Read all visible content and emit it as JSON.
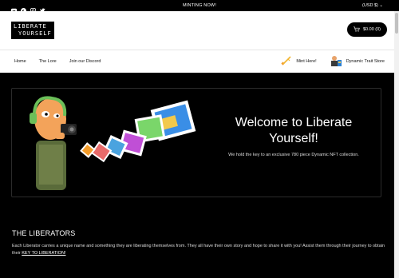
{
  "topbar": {
    "announcement": "MINTING NOW!",
    "currency": "(USD $) ⌄",
    "social_icons": [
      "discord-icon",
      "opensea-icon",
      "instagram-icon",
      "twitter-icon"
    ]
  },
  "header": {
    "logo_line1": "LIBERATE",
    "logo_line2": "YOURSELF",
    "cart_label": "$0.00 (0)"
  },
  "nav": {
    "items": [
      "Home",
      "The Lore",
      "Join our Discord"
    ],
    "mint_label": "Mint Here!",
    "store_label": "Dynamic Trait Store"
  },
  "hero": {
    "title": "Welcome to Liberate Yourself!",
    "text": "We hold the key to an exclusive 780 piece Dynamic NFT collection."
  },
  "section": {
    "title": "THE LIBERATORS",
    "text": "Each Liberator carries a unique name and something they are liberating themselves from. They all have their own story and hope to share it with you! Assist them through their journey to obtain their ",
    "link": "KEY TO LIBERATION!"
  },
  "colors": {
    "background": "#000000",
    "header_bg": "#ffffff",
    "accent_orange": "#f39c2a"
  }
}
